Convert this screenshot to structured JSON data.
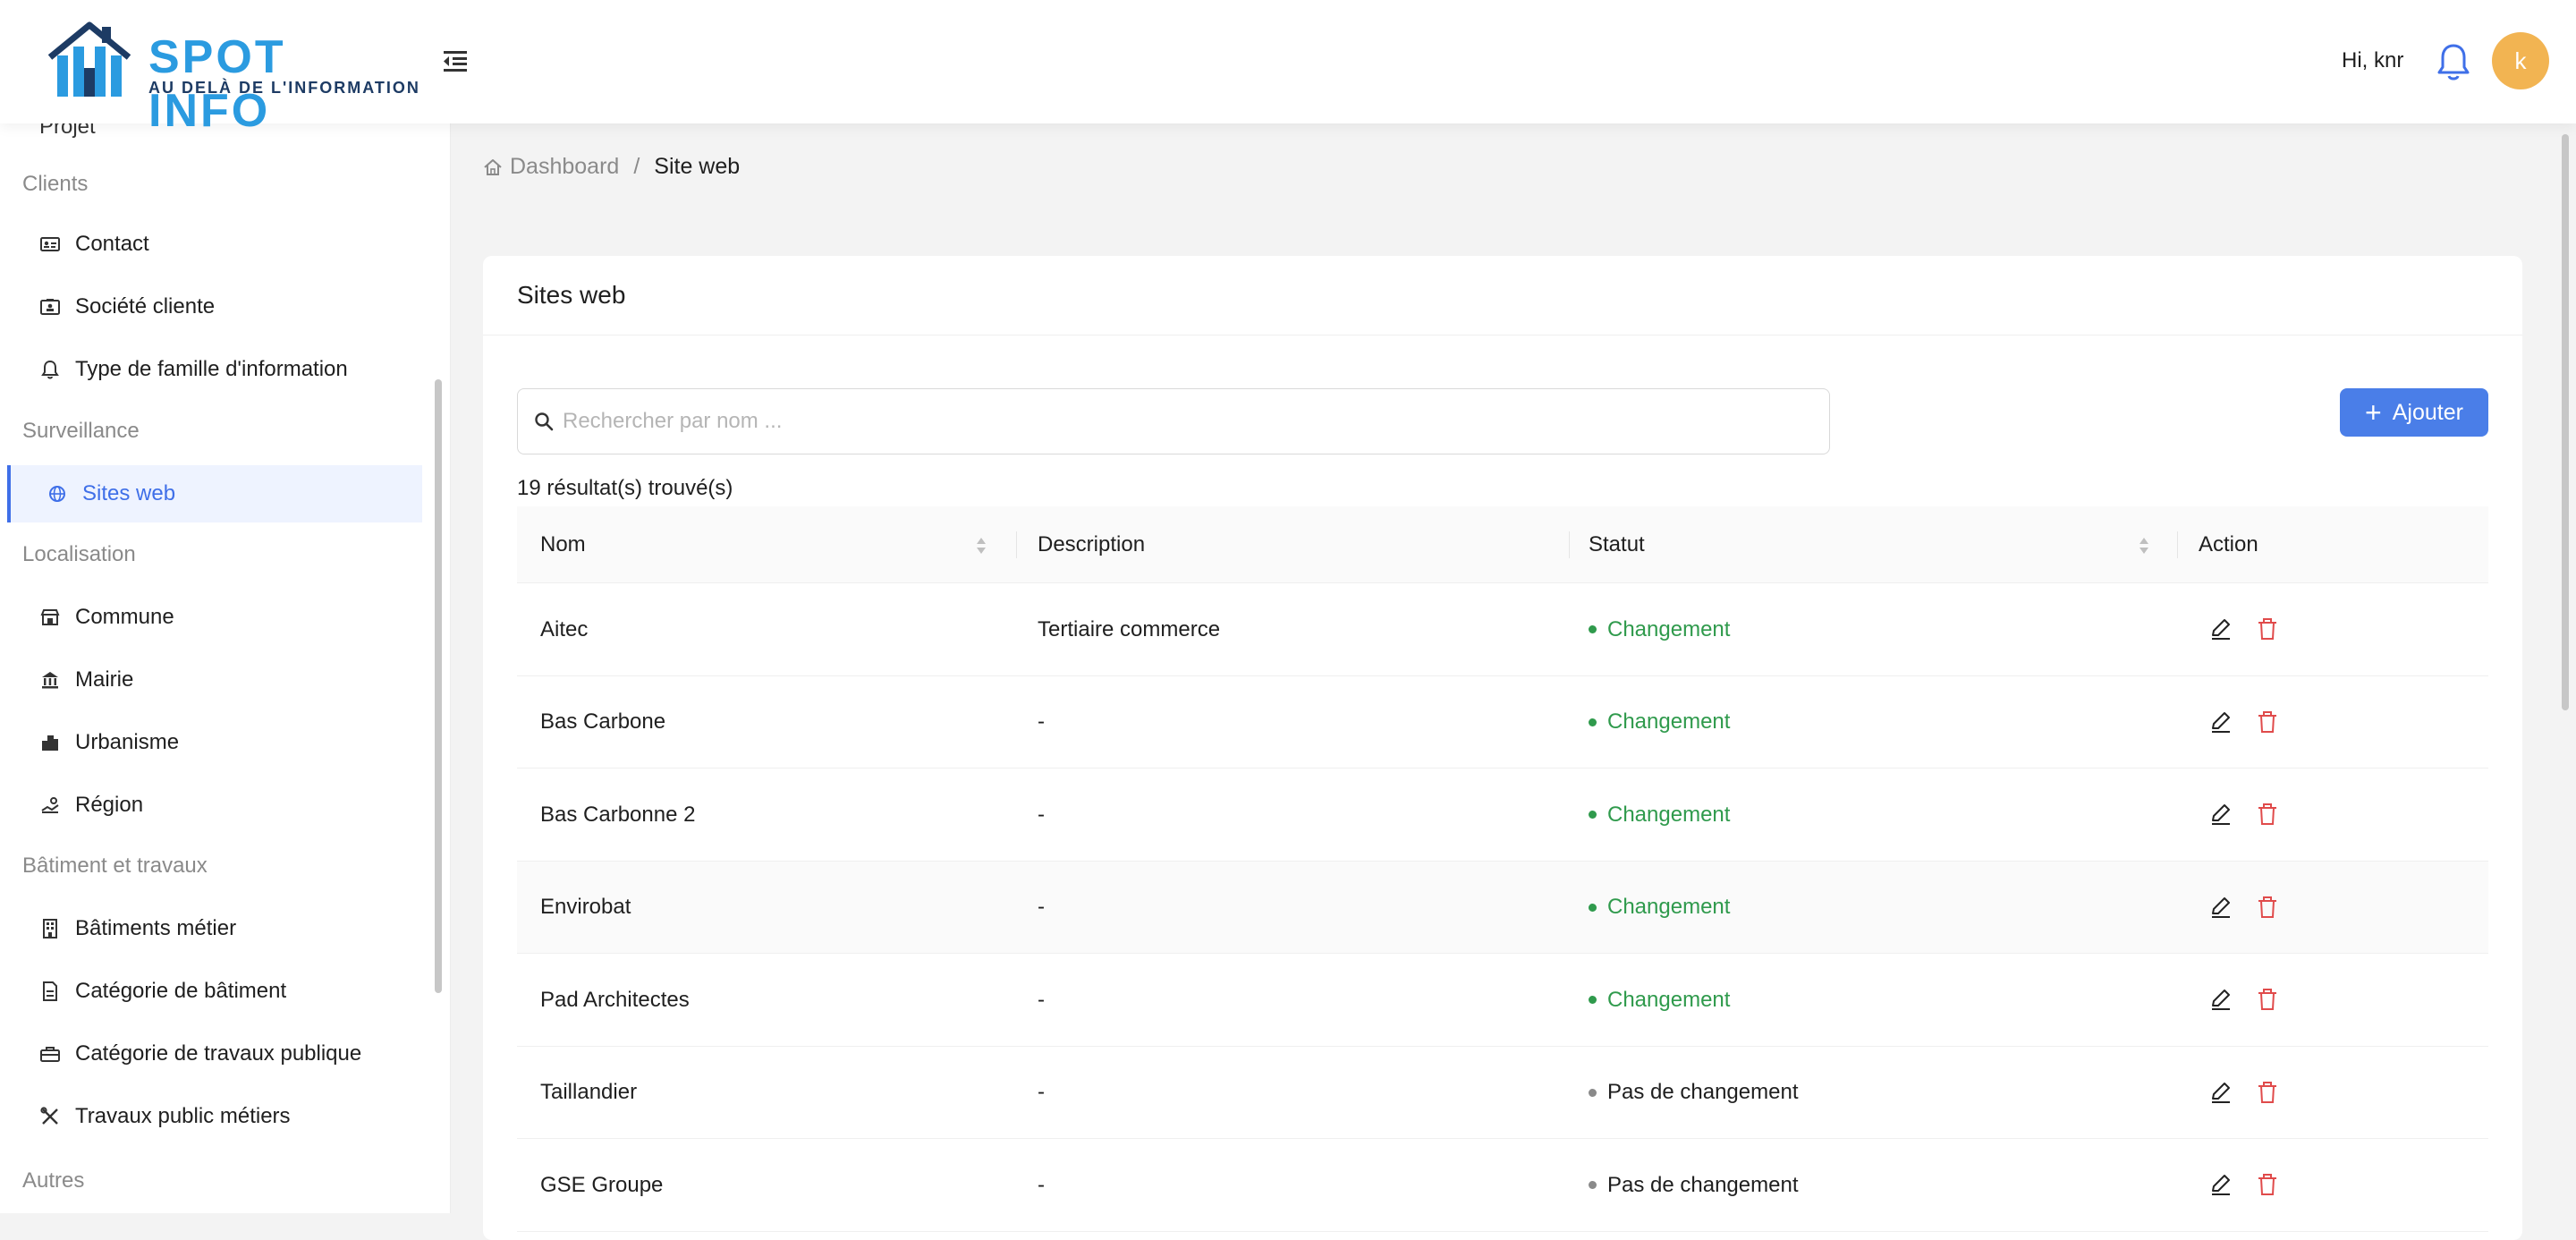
{
  "header": {
    "logo_title": "SPOT INFO",
    "logo_subtitle": "AU DELÀ DE L'INFORMATION",
    "greeting": "Hi, knr",
    "avatar_letter": "k",
    "brand_color": "#2b9be0",
    "accent_color": "#3f6fe8"
  },
  "sidebar": {
    "partial_item": "Projet",
    "groups": {
      "clients": "Clients",
      "surveillance": "Surveillance",
      "localisation": "Localisation",
      "batiment": "Bâtiment et travaux",
      "autres": "Autres"
    },
    "items": [
      {
        "label": "Contact",
        "icon": "contact-card-icon"
      },
      {
        "label": "Société cliente",
        "icon": "company-icon"
      },
      {
        "label": "Type de famille d'information",
        "icon": "bell-icon"
      },
      {
        "label": "Sites web",
        "icon": "globe-icon",
        "active": true
      },
      {
        "label": "Commune",
        "icon": "shop-icon"
      },
      {
        "label": "Mairie",
        "icon": "bank-icon"
      },
      {
        "label": "Urbanisme",
        "icon": "city-icon"
      },
      {
        "label": "Région",
        "icon": "map-icon"
      },
      {
        "label": "Bâtiments métier",
        "icon": "building-icon"
      },
      {
        "label": "Catégorie de bâtiment",
        "icon": "file-icon"
      },
      {
        "label": "Catégorie de travaux publique",
        "icon": "toolbox-icon"
      },
      {
        "label": "Travaux public métiers",
        "icon": "tools-icon"
      }
    ]
  },
  "breadcrumb": {
    "home": "Dashboard",
    "separator": "/",
    "current": "Site web"
  },
  "card": {
    "title": "Sites web",
    "search_placeholder": "Rechercher par nom ...",
    "add_label": "Ajouter",
    "results": "19 résultat(s) trouvé(s)"
  },
  "table": {
    "columns": {
      "nom": "Nom",
      "description": "Description",
      "statut": "Statut",
      "action": "Action"
    },
    "rows": [
      {
        "nom": "Aitec",
        "description": "Tertiaire commerce",
        "statut": "Changement",
        "changed": true
      },
      {
        "nom": "Bas Carbone",
        "description": "-",
        "statut": "Changement",
        "changed": true
      },
      {
        "nom": "Bas Carbonne 2",
        "description": "-",
        "statut": "Changement",
        "changed": true
      },
      {
        "nom": "Envirobat",
        "description": "-",
        "statut": "Changement",
        "changed": true
      },
      {
        "nom": "Pad Architectes",
        "description": "-",
        "statut": "Changement",
        "changed": true
      },
      {
        "nom": "Taillandier",
        "description": "-",
        "statut": "Pas de changement",
        "changed": false
      },
      {
        "nom": "GSE Groupe",
        "description": "-",
        "statut": "Pas de changement",
        "changed": false
      }
    ],
    "status_colors": {
      "changed": "#2f9a4c",
      "unchanged": "#8a8a8a"
    }
  }
}
